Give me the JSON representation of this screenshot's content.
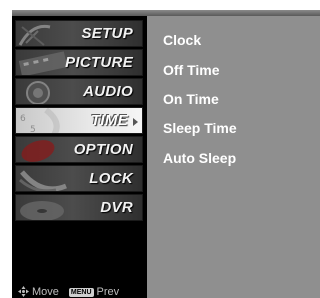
{
  "menu": {
    "items": [
      {
        "label": "SETUP",
        "icon": "satellite-dish-icon"
      },
      {
        "label": "PICTURE",
        "icon": "film-strip-icon"
      },
      {
        "label": "AUDIO",
        "icon": "speaker-icon"
      },
      {
        "label": "TIME",
        "icon": "clock-icon",
        "selected": true
      },
      {
        "label": "OPTION",
        "icon": "option-tag-icon"
      },
      {
        "label": "LOCK",
        "icon": "lock-icon"
      },
      {
        "label": "DVR",
        "icon": "disc-icon"
      }
    ]
  },
  "submenu": {
    "items": [
      "Clock",
      "Off Time",
      "On Time",
      "Sleep Time",
      "Auto Sleep"
    ]
  },
  "footer": {
    "move_label": "Move",
    "menu_key": "MENU",
    "prev_label": "Prev"
  },
  "colors": {
    "submenu_bg": "#8f8f8f",
    "menu_bg": "#000000",
    "selected_item": "#e9e9e9"
  }
}
